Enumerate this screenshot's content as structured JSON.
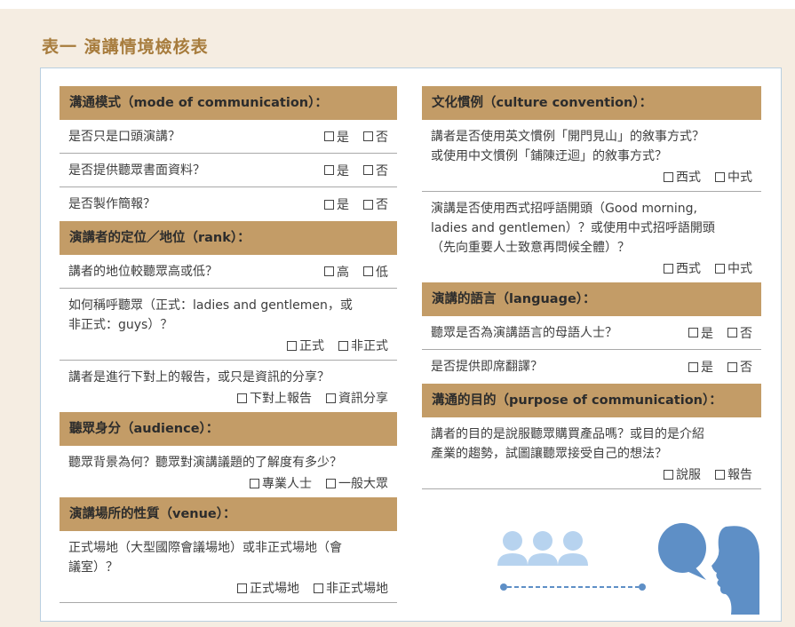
{
  "title": "表一 演講情境檢核表",
  "left": {
    "s1": {
      "title": "溝通模式（mode of communication）：",
      "q1": {
        "text": "是否只是口頭演講？",
        "o1": "是",
        "o2": "否"
      },
      "q2": {
        "text": "是否提供聽眾書面資料？",
        "o1": "是",
        "o2": "否"
      },
      "q3": {
        "text": "是否製作簡報？",
        "o1": "是",
        "o2": "否"
      }
    },
    "s2": {
      "title": "演講者的定位／地位（rank）：",
      "q1": {
        "text": "講者的地位較聽眾高或低？",
        "o1": "高",
        "o2": "低"
      },
      "q2": {
        "line1": "如何稱呼聽眾（正式：ladies and gentlemen，或",
        "line2": "非正式：guys）？",
        "o1": "正式",
        "o2": "非正式"
      },
      "q3": {
        "text": "講者是進行下對上的報告，或只是資訊的分享？",
        "o1": "下對上報告",
        "o2": "資訊分享"
      }
    },
    "s3": {
      "title": "聽眾身分（audience）：",
      "q1": {
        "text": "聽眾背景為何？聽眾對演講議題的了解度有多少？",
        "o1": "專業人士",
        "o2": "一般大眾"
      }
    },
    "s4": {
      "title": "演講場所的性質（venue）：",
      "q1": {
        "line1": "正式場地（大型國際會議場地）或非正式場地（會",
        "line2": "議室）？",
        "o1": "正式場地",
        "o2": "非正式場地"
      }
    }
  },
  "right": {
    "s1": {
      "title": "文化慣例（culture convention）：",
      "q1": {
        "line1": "講者是否使用英文慣例「開門見山」的敘事方式？",
        "line2": "或使用中文慣例「鋪陳迂迴」的敘事方式？",
        "o1": "西式",
        "o2": "中式"
      },
      "q2": {
        "line1": "演講是否使用西式招呼語開頭（Good morning,",
        "line2": "ladies and gentlemen）？或使用中式招呼語開頭",
        "line3": "（先向重要人士致意再問候全體）？",
        "o1": "西式",
        "o2": "中式"
      }
    },
    "s2": {
      "title": "演講的語言（language）：",
      "q1": {
        "text": "聽眾是否為演講語言的母語人士？",
        "o1": "是",
        "o2": "否"
      },
      "q2": {
        "text": "是否提供即席翻譯？",
        "o1": "是",
        "o2": "否"
      }
    },
    "s3": {
      "title": "溝通的目的（purpose of communication）：",
      "q1": {
        "line1": "講者的目的是說服聽眾購買產品嗎？或目的是介紹",
        "line2": "產業的趨勢，試圖讓聽眾接受自己的想法？",
        "o1": "說服",
        "o2": "報告"
      }
    }
  },
  "colors": {
    "header_bg": "#c39c67",
    "title": "#a77c3d",
    "illus_blue": "#5e8fc6",
    "illus_light": "#b7d3ef"
  },
  "illustration": {
    "icons": [
      "audience-icon",
      "speaker-icon",
      "speech-bubble-icon"
    ]
  }
}
